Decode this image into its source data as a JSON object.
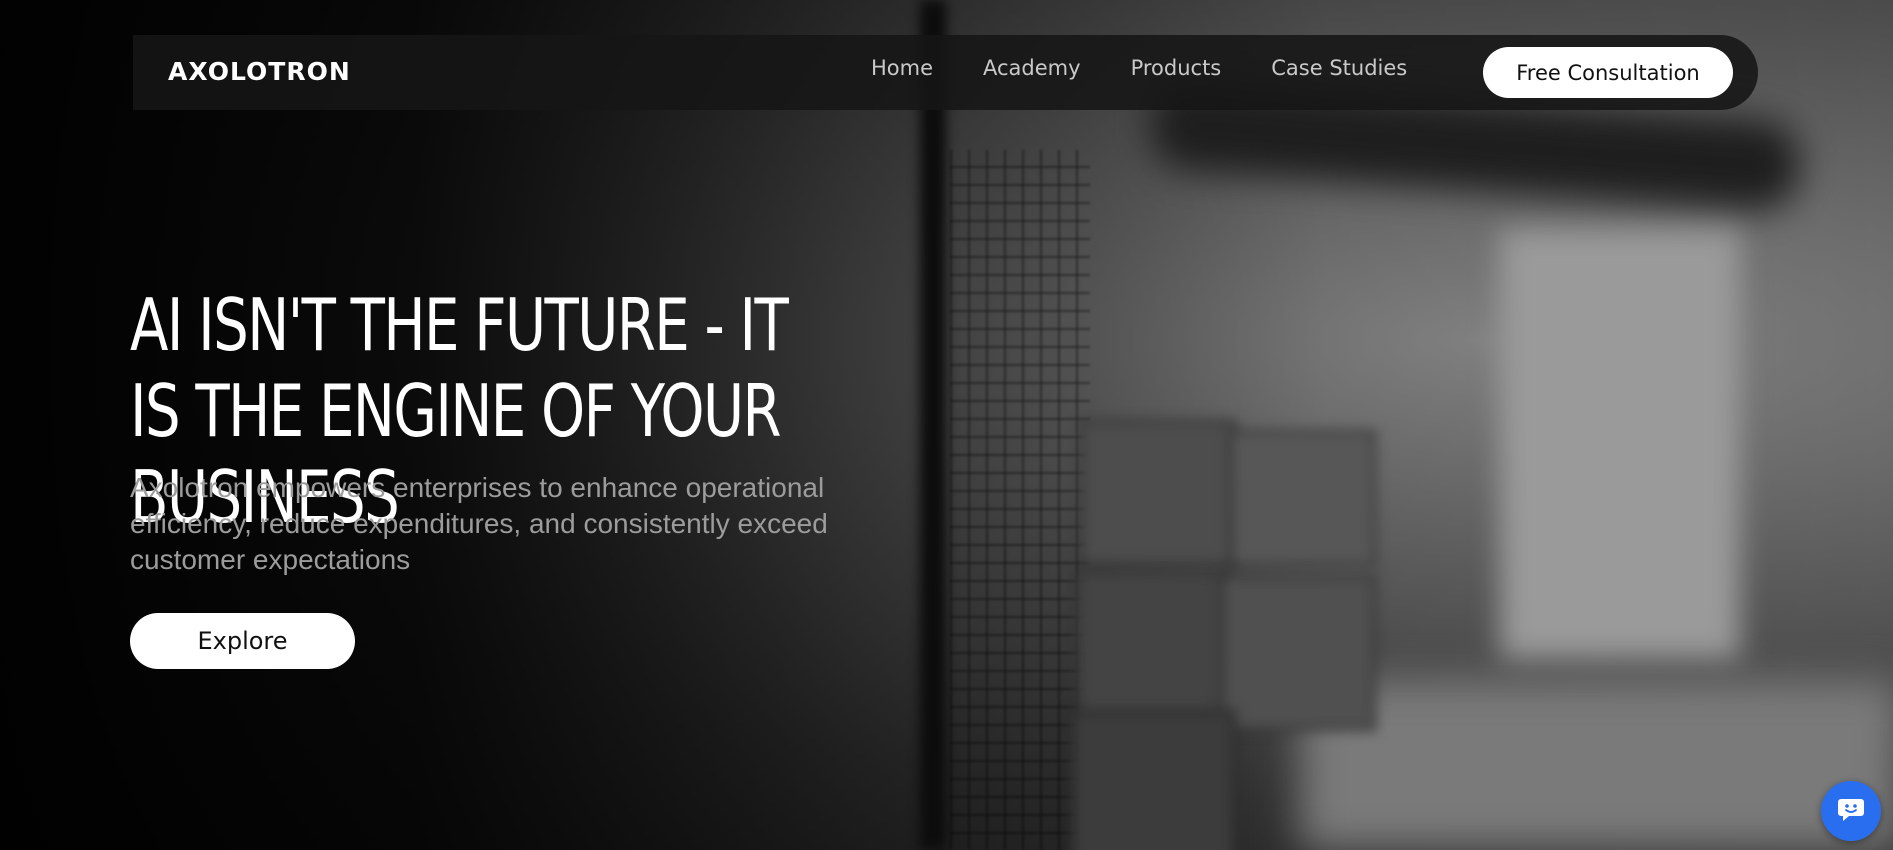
{
  "brand": {
    "logo_text": "AXOLOTRON"
  },
  "nav": {
    "items": [
      {
        "label": "Home"
      },
      {
        "label": "Academy"
      },
      {
        "label": "Products"
      },
      {
        "label": "Case Studies"
      }
    ],
    "cta_label": "Free Consultation"
  },
  "hero": {
    "headline": "AI ISN'T THE FUTURE - IT IS THE ENGINE OF YOUR BUSINESS",
    "subtext": "Axolotron empowers enterprises to enhance operational efficiency, reduce expenditures, and consistently exceed customer expectations",
    "button_label": "Explore"
  },
  "chat_widget": {
    "icon": "chat-bubble-icon",
    "color": "#2a6ef0"
  },
  "colors": {
    "background": "#000000",
    "nav_text": "#c9c9c9",
    "subtext": "#9c9c9c",
    "button_bg": "#ffffff"
  }
}
